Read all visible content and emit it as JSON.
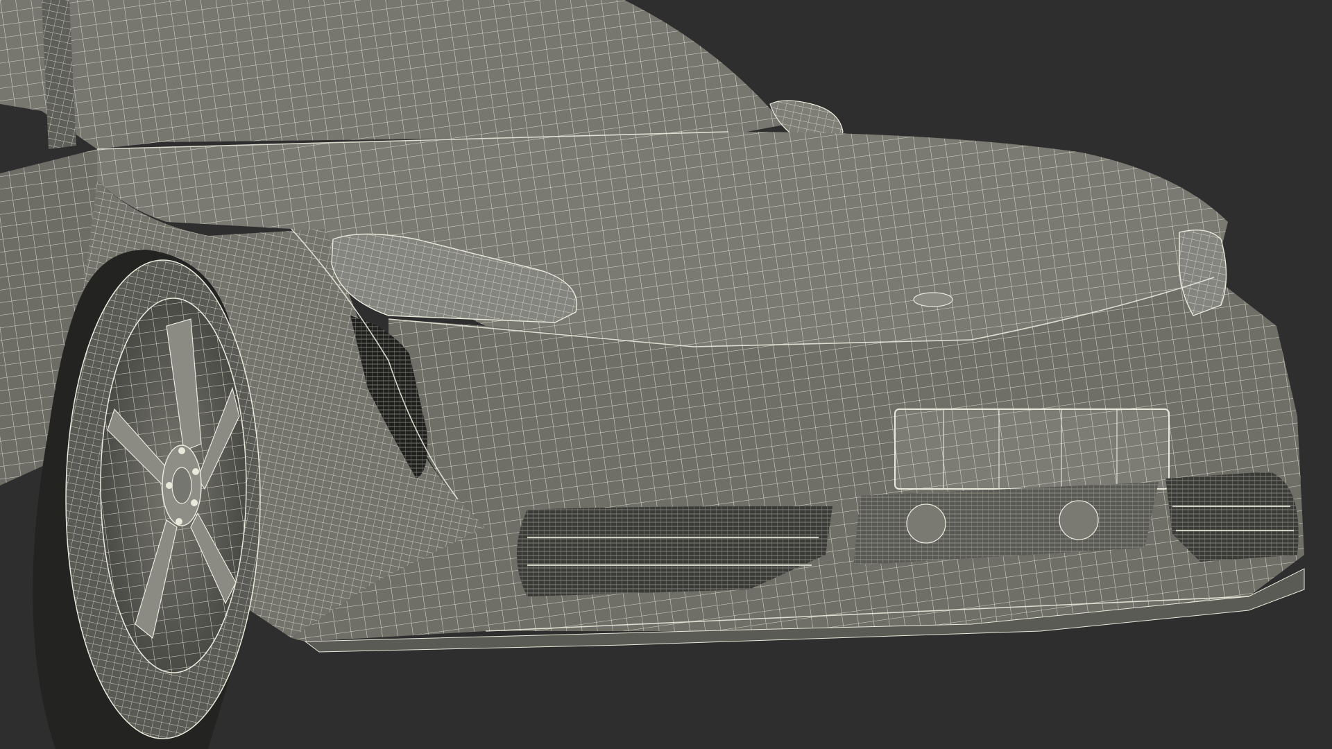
{
  "scene": {
    "subject": "wireframe-car-front",
    "colors": {
      "background": "#2e2e2e",
      "surface": "#6f6f68",
      "surface_light": "#8a8a82",
      "surface_dark": "#4e4e49",
      "shadow": "#1f1f1e",
      "wire": "#e9e9dc",
      "grille": "#3a3a37"
    }
  }
}
